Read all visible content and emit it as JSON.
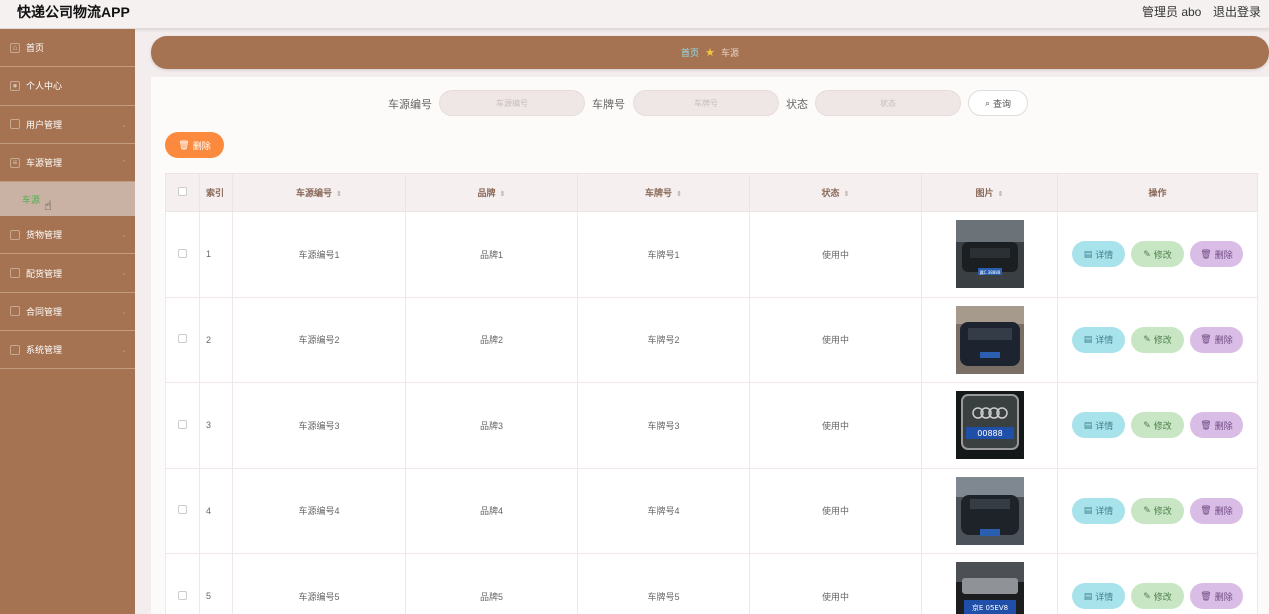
{
  "header": {
    "app_title": "快递公司物流APP",
    "admin_label": "管理员 abo",
    "logout_label": "退出登录"
  },
  "sidebar": {
    "items": [
      {
        "label": "首页",
        "icon": "home-icon"
      },
      {
        "label": "个人中心",
        "icon": "user-icon"
      },
      {
        "label": "用户管理",
        "icon": "users-icon"
      },
      {
        "label": "车源管理",
        "icon": "list-icon"
      },
      {
        "label": "货物管理",
        "icon": "box-icon"
      },
      {
        "label": "配货管理",
        "icon": "dispatch-icon"
      },
      {
        "label": "合同管理",
        "icon": "contract-icon"
      },
      {
        "label": "系统管理",
        "icon": "settings-icon"
      }
    ],
    "sub_item": {
      "label": "车源"
    }
  },
  "breadcrumb": {
    "home": "首页",
    "current": "车源"
  },
  "search": {
    "field1": {
      "label": "车源编号",
      "placeholder": "车源编号"
    },
    "field2": {
      "label": "车牌号",
      "placeholder": "车牌号"
    },
    "field3": {
      "label": "状态",
      "placeholder": "状态"
    },
    "query_label": "查询"
  },
  "toolbar": {
    "delete_label": "删除"
  },
  "table": {
    "headers": {
      "index": "索引",
      "source_no": "车源编号",
      "brand": "品牌",
      "plate": "车牌号",
      "status": "状态",
      "image": "图片",
      "ops": "操作"
    },
    "rows": [
      {
        "index": "1",
        "source_no": "车源编号1",
        "brand": "品牌1",
        "plate": "车牌号1",
        "status": "使用中",
        "img_text": "冀C 38888"
      },
      {
        "index": "2",
        "source_no": "车源编号2",
        "brand": "品牌2",
        "plate": "车牌号2",
        "status": "使用中",
        "img_text": ""
      },
      {
        "index": "3",
        "source_no": "车源编号3",
        "brand": "品牌3",
        "plate": "车牌号3",
        "status": "使用中",
        "img_text": "00888"
      },
      {
        "index": "4",
        "source_no": "车源编号4",
        "brand": "品牌4",
        "plate": "车牌号4",
        "status": "使用中",
        "img_text": ""
      },
      {
        "index": "5",
        "source_no": "车源编号5",
        "brand": "品牌5",
        "plate": "车牌号5",
        "status": "使用中",
        "img_text": "京E 05EV8"
      }
    ],
    "actions": {
      "detail": "详情",
      "edit": "修改",
      "delete": "删除"
    }
  }
}
